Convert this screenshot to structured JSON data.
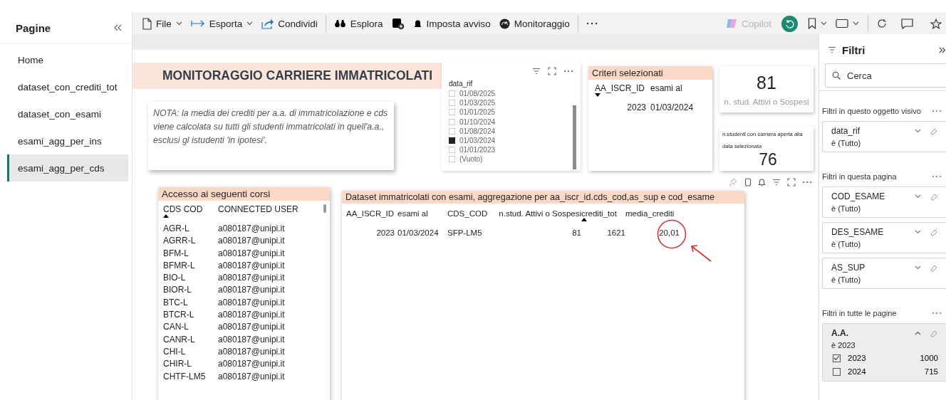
{
  "sidebar": {
    "title": "Pagine",
    "items": [
      {
        "label": "Home",
        "selected": false
      },
      {
        "label": "dataset_con_crediti_tot",
        "selected": false
      },
      {
        "label": "dataset_con_esami",
        "selected": false
      },
      {
        "label": "esami_agg_per_ins",
        "selected": false
      },
      {
        "label": "esami_agg_per_cds",
        "selected": true
      }
    ]
  },
  "toolbar": {
    "groups": [
      [
        {
          "kind": "text",
          "label": "File",
          "dropdown": true
        },
        {
          "kind": "text",
          "label": "Esporta",
          "dropdown": true
        },
        {
          "kind": "text",
          "label": "Condividi",
          "dropdown": false
        }
      ],
      [
        {
          "kind": "text",
          "label": "Esplora",
          "dropdown": false
        },
        {
          "kind": "icon"
        },
        {
          "kind": "text",
          "label": "Imposta avviso",
          "dropdown": false
        },
        {
          "kind": "text",
          "label": "Monitoraggio",
          "dropdown": false
        }
      ]
    ],
    "copilot": {
      "label": "Copilot",
      "disabled": true
    }
  },
  "report": {
    "title": "MONITORAGGIO CARRIERE IMMATRICOLATI",
    "note": "NOTA: la media dei crediti per a.a. di immatricolazione e cds viene calcolata su tutti gli studenti immatricolati in quell'a.a., esclusi gl istudenti 'in ipotesi'.",
    "slicer": {
      "field": "data_rif",
      "options": [
        {
          "label": "01/08/2025",
          "checked": false
        },
        {
          "label": "01/03/2025",
          "checked": false
        },
        {
          "label": "01/01/2025",
          "checked": false
        },
        {
          "label": "01/10/2024",
          "checked": false
        },
        {
          "label": "01/08/2024",
          "checked": false
        },
        {
          "label": "01/03/2024",
          "checked": true
        },
        {
          "label": "01/01/2023",
          "checked": false
        },
        {
          "label": "(Vuoto)",
          "checked": false
        }
      ]
    },
    "criteria": {
      "title": "Criteri selezionati",
      "columns": [
        {
          "label": "AA_ISCR_ID",
          "sorted": true,
          "descending": true
        },
        {
          "label": "esami al",
          "sorted": false
        }
      ],
      "rows": [
        [
          "2023",
          "01/03/2024"
        ]
      ]
    },
    "cards": [
      {
        "kind": "value_first",
        "value": "81",
        "label": "n. stud. Attivi o Sospesi"
      },
      {
        "kind": "label_first",
        "label": "n.studenti con carriera aperta alla data selezionata",
        "value": "76"
      }
    ],
    "access_table": {
      "title": "Accesso ai seguenti corsi",
      "columns": [
        {
          "label": "CDS COD",
          "sorted": true,
          "descending": false
        },
        {
          "label": "CONNECTED USER",
          "sorted": false
        }
      ],
      "rows": [
        [
          "AGR-L",
          "a080187@unipi.it"
        ],
        [
          "AGRR-L",
          "a080187@unipi.it"
        ],
        [
          "BFM-L",
          "a080187@unipi.it"
        ],
        [
          "BFMR-L",
          "a080187@unipi.it"
        ],
        [
          "BIO-L",
          "a080187@unipi.it"
        ],
        [
          "BIOR-L",
          "a080187@unipi.it"
        ],
        [
          "BTC-L",
          "a080187@unipi.it"
        ],
        [
          "BTCR-L",
          "a080187@unipi.it"
        ],
        [
          "CAN-L",
          "a080187@unipi.it"
        ],
        [
          "CANR-L",
          "a080187@unipi.it"
        ],
        [
          "CHI-L",
          "a080187@unipi.it"
        ],
        [
          "CHIR-L",
          "a080187@unipi.it"
        ],
        [
          "CHTF-LM5",
          "a080187@unipi.it"
        ]
      ]
    },
    "dataset_table": {
      "title": "Dataset immatricolati con esami, aggregazione per aa_iscr_id.cds_cod,as_sup e cod_esame",
      "columns": [
        {
          "label": "AA_ISCR_ID",
          "sorted": false
        },
        {
          "label": "esami al",
          "sorted": false
        },
        {
          "label": "CDS_COD",
          "sorted": false
        },
        {
          "label": "n.stud. Attivi o Sospesi",
          "sorted": false
        },
        {
          "label": "crediti_tot",
          "sorted": true,
          "descending": false
        },
        {
          "label": "media_crediti",
          "sorted": false
        }
      ],
      "rows": [
        [
          {
            "text": "2023",
            "circled": false
          },
          {
            "text": "01/03/2024",
            "circled": false
          },
          {
            "text": "SFP-LM5",
            "circled": false
          },
          {
            "text": "81",
            "circled": false
          },
          {
            "text": "1621",
            "circled": false
          },
          {
            "text": "20,01",
            "circled": true
          }
        ]
      ]
    }
  },
  "filters": {
    "title": "Filtri",
    "search_placeholder": "Cerca",
    "sections": [
      {
        "title": "Filtri in questo oggetto visivo",
        "filters": [
          {
            "field": "data_rif",
            "condition": "è (Tutto)",
            "expanded": false
          }
        ]
      },
      {
        "title": "Filtri in questa pagina",
        "filters": [
          {
            "field": "COD_ESAME",
            "condition": "è (Tutto)",
            "expanded": false
          },
          {
            "field": "DES_ESAME",
            "condition": "è (Tutto)",
            "expanded": false
          },
          {
            "field": "AS_SUP",
            "condition": "è (Tutto)",
            "expanded": false
          }
        ]
      },
      {
        "title": "Filtri in tutte le pagine",
        "filters": [
          {
            "field": "A.A.",
            "condition": "è 2023",
            "expanded": true,
            "options": [
              {
                "label": "2023",
                "count": "1000",
                "checked": true
              },
              {
                "label": "2024",
                "count": "715",
                "checked": false
              }
            ]
          }
        ]
      }
    ]
  }
}
